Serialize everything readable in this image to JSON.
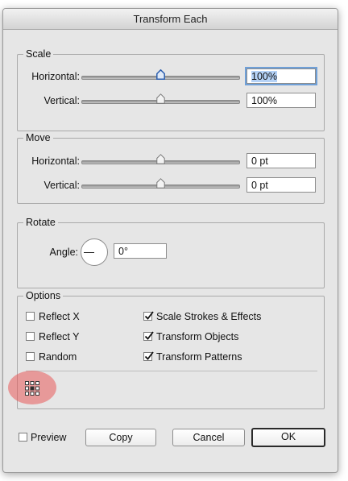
{
  "window": {
    "title": "Transform Each"
  },
  "scale": {
    "legend": "Scale",
    "horizontal": {
      "label": "Horizontal:",
      "value": "100%",
      "slider_position": 0.5
    },
    "vertical": {
      "label": "Vertical:",
      "value": "100%",
      "slider_position": 0.5
    }
  },
  "move": {
    "legend": "Move",
    "horizontal": {
      "label": "Horizontal:",
      "value": "0 pt",
      "slider_position": 0.5
    },
    "vertical": {
      "label": "Vertical:",
      "value": "0 pt",
      "slider_position": 0.5
    }
  },
  "rotate": {
    "legend": "Rotate",
    "angle_label": "Angle:",
    "angle_value": "0°"
  },
  "options": {
    "legend": "Options",
    "checkboxes": [
      {
        "label": "Reflect X",
        "checked": false
      },
      {
        "label": "Reflect Y",
        "checked": false
      },
      {
        "label": "Random",
        "checked": false
      },
      {
        "label": "Scale Strokes & Effects",
        "checked": true
      },
      {
        "label": "Transform Objects",
        "checked": true
      },
      {
        "label": "Transform Patterns",
        "checked": true
      }
    ],
    "reference_point_icon": "reference-point-grid",
    "highlight_color": "#e85a5a"
  },
  "footer": {
    "preview_label": "Preview",
    "preview_checked": false,
    "copy_label": "Copy",
    "cancel_label": "Cancel",
    "ok_label": "OK"
  },
  "colors": {
    "focus_ring": "#6fa0d8",
    "selection": "#b5d2f6",
    "dialog_bg": "#e6e6e6"
  }
}
